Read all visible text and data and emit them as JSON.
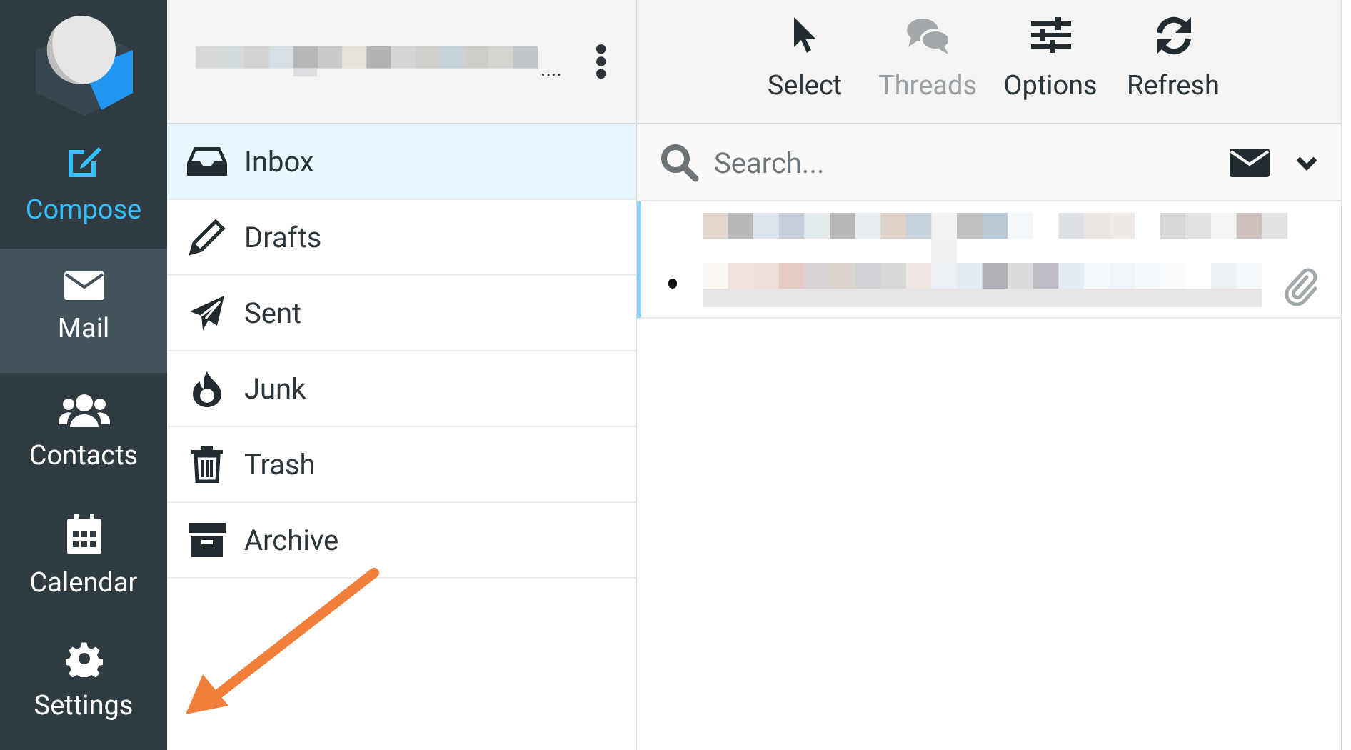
{
  "sidebar": {
    "items": [
      {
        "label": "Compose",
        "selected": false
      },
      {
        "label": "Mail",
        "selected": true
      },
      {
        "label": "Contacts",
        "selected": false
      },
      {
        "label": "Calendar",
        "selected": false
      },
      {
        "label": "Settings",
        "selected": false
      }
    ]
  },
  "account": {
    "ellipsis": "...."
  },
  "folders": [
    {
      "label": "Inbox",
      "selected": true
    },
    {
      "label": "Drafts",
      "selected": false
    },
    {
      "label": "Sent",
      "selected": false
    },
    {
      "label": "Junk",
      "selected": false
    },
    {
      "label": "Trash",
      "selected": false
    },
    {
      "label": "Archive",
      "selected": false
    }
  ],
  "toolbar": [
    {
      "label": "Select",
      "disabled": false
    },
    {
      "label": "Threads",
      "disabled": true
    },
    {
      "label": "Options",
      "disabled": false
    },
    {
      "label": "Refresh",
      "disabled": false
    }
  ],
  "search": {
    "placeholder": "Search..."
  },
  "messages": [
    {
      "selected": true,
      "unread": true,
      "has_attachment": true
    }
  ]
}
